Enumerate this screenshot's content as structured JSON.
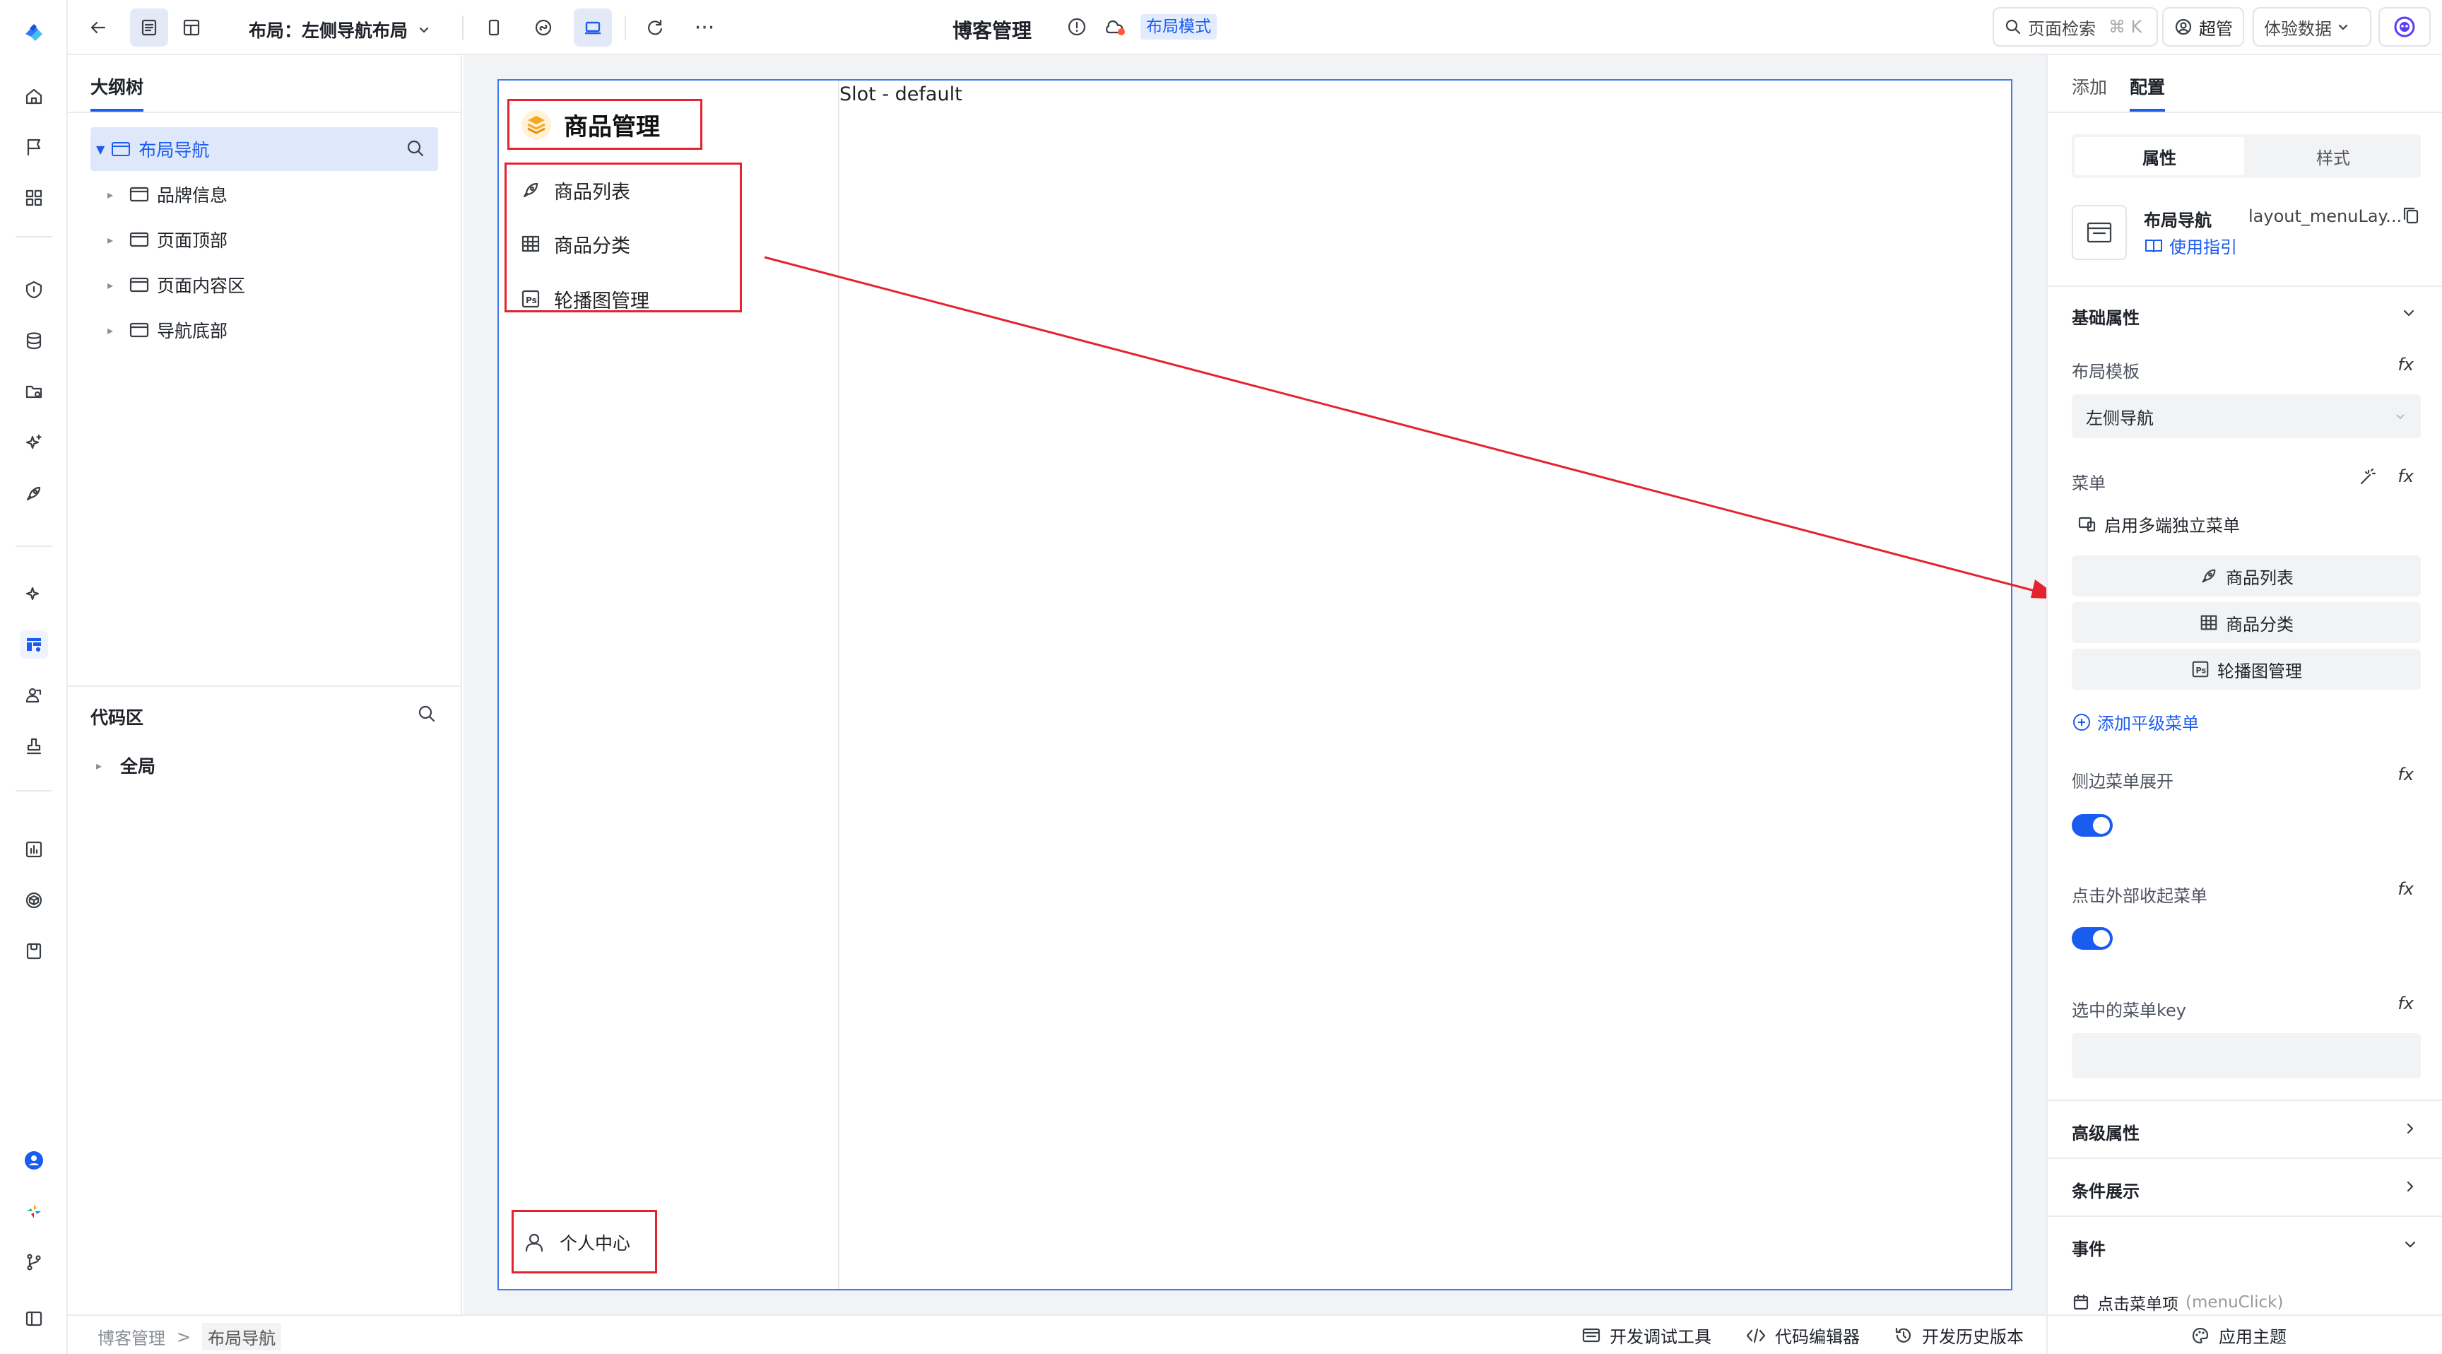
{
  "topbar": {
    "layout_label": "布局：左侧导航布局",
    "app_title": "博客管理",
    "mode_badge": "布局模式",
    "search_placeholder": "页面检索",
    "search_shortcut": "⌘ K",
    "user_name": "超管",
    "experience_data": "体验数据",
    "more": "···"
  },
  "outline": {
    "tab": "大纲树",
    "root": "布局导航",
    "children": [
      "品牌信息",
      "页面顶部",
      "页面内容区",
      "导航底部"
    ],
    "code_title": "代码区",
    "code_root": "全局"
  },
  "canvas": {
    "brand_title": "商品管理",
    "menu": [
      "商品列表",
      "商品分类",
      "轮播图管理"
    ],
    "slot_label": "Slot - default",
    "footer_item": "个人中心"
  },
  "right": {
    "tabs": [
      "添加",
      "配置"
    ],
    "segments": [
      "属性",
      "样式"
    ],
    "component_name": "布局导航",
    "component_id": "layout_menuLay...",
    "usage_link": "使用指引",
    "basic_props": "基础属性",
    "layout_template_label": "布局模板",
    "layout_template_value": "左侧导航",
    "menu_label": "菜单",
    "multi_menu": "启用多端独立菜单",
    "menu_items": [
      "商品列表",
      "商品分类",
      "轮播图管理"
    ],
    "add_menu": "添加平级菜单",
    "side_expand": "侧边菜单展开",
    "click_outside": "点击外部收起菜单",
    "selected_key": "选中的菜单key",
    "advanced": "高级属性",
    "conditional": "条件展示",
    "events": "事件",
    "event_item": "点击菜单项",
    "event_code": "(menuClick)",
    "fx": "fx",
    "toggle_side_expand": true,
    "toggle_click_outside": true
  },
  "footer": {
    "breadcrumb": [
      "博客管理",
      "布局导航"
    ],
    "debug": "开发调试工具",
    "editor": "代码编辑器",
    "history": "开发历史版本",
    "theme": "应用主题"
  },
  "colors": {
    "accent": "#1a5bf0",
    "highlight": "#e5232e",
    "selected_bg": "#dfe7fb"
  }
}
